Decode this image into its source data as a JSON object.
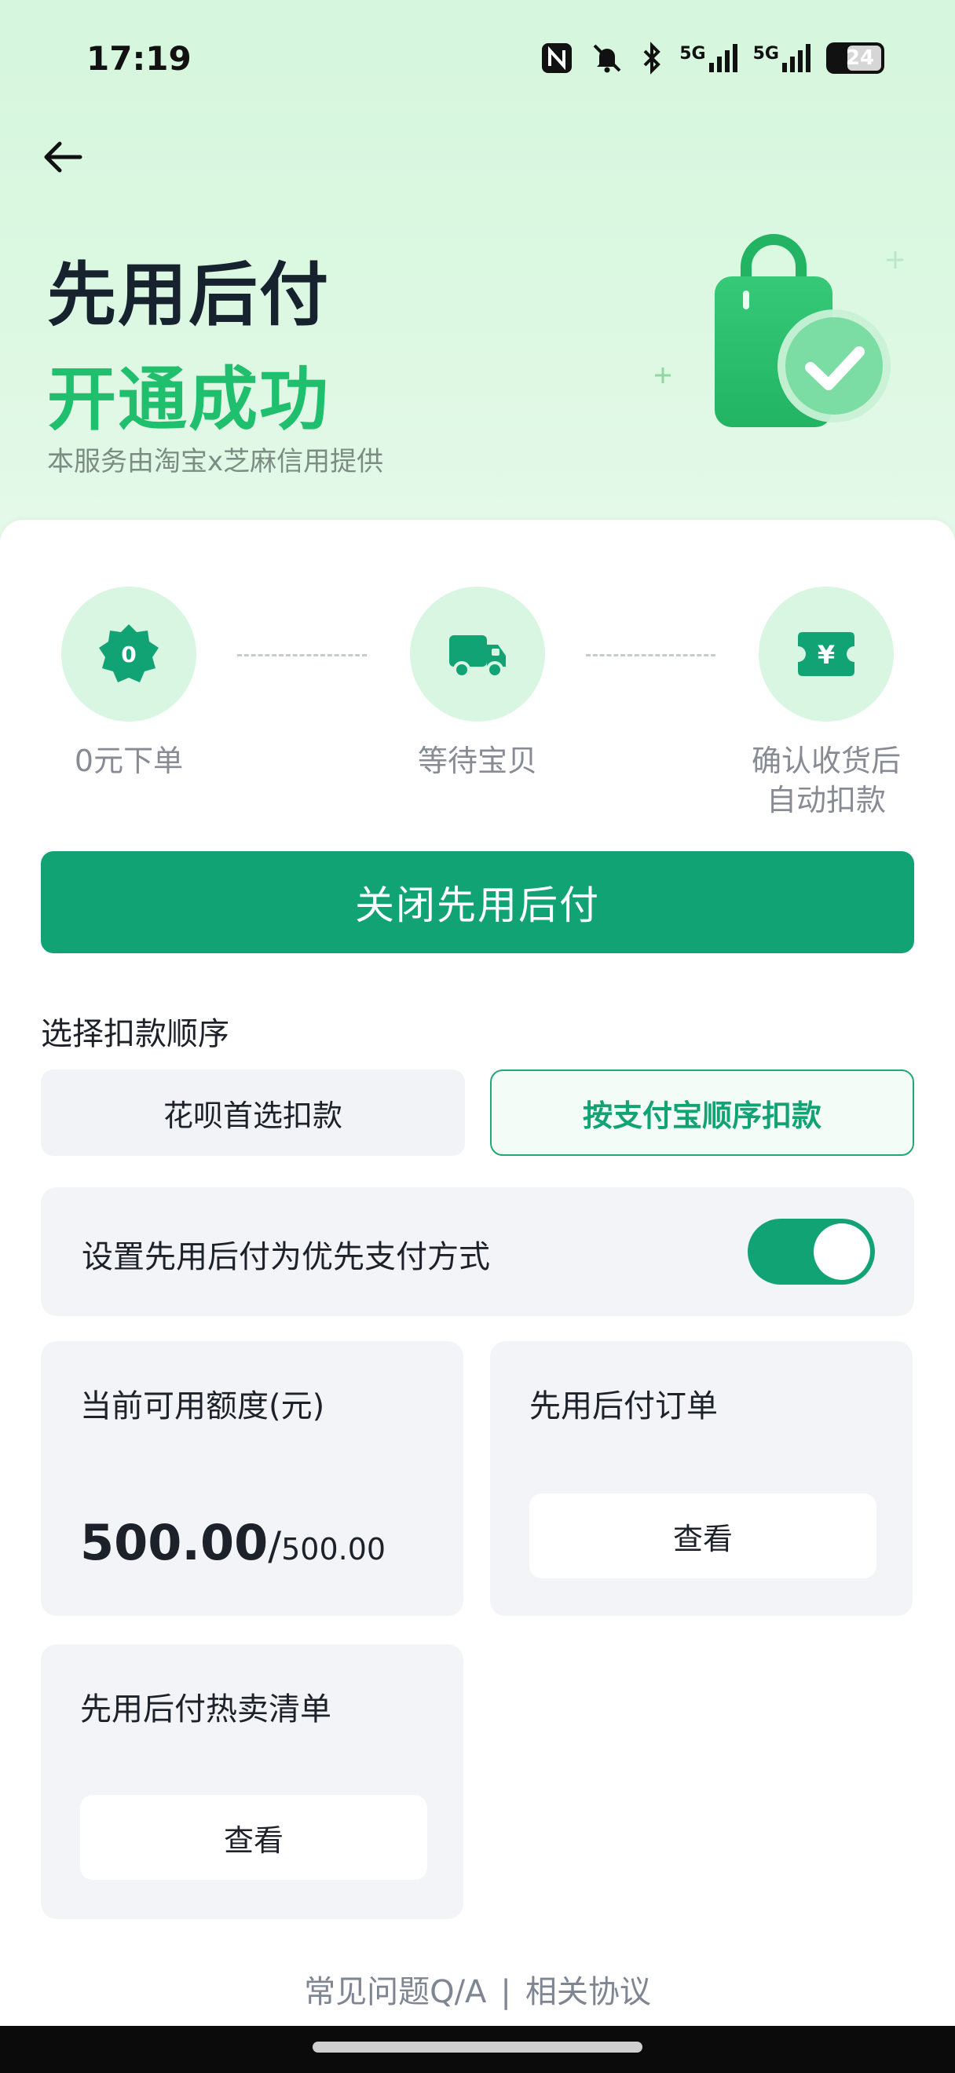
{
  "status_bar": {
    "time": "17:19",
    "icons": [
      "nfc-icon",
      "mute-icon",
      "bluetooth-icon",
      "signal-5g-icon",
      "signal-5g-icon",
      "battery-icon"
    ],
    "network_label_1": "5G",
    "network_label_2": "5G",
    "battery_level": "24"
  },
  "header": {
    "back_icon": "arrow-left-icon",
    "title_line1": "先用后付",
    "title_line2": "开通成功",
    "subtitle": "本服务由淘宝x芝麻信用提供"
  },
  "steps": [
    {
      "icon": "zero-badge-icon",
      "icon_text": "0",
      "label": "0元下单"
    },
    {
      "icon": "truck-icon",
      "label": "等待宝贝"
    },
    {
      "icon": "yuan-ticket-icon",
      "icon_text": "¥",
      "label_line1": "确认收货后",
      "label_line2": "自动扣款"
    }
  ],
  "main_button": {
    "label": "关闭先用后付"
  },
  "payment_order": {
    "title": "选择扣款顺序",
    "options": [
      {
        "label": "花呗首选扣款",
        "selected": false
      },
      {
        "label": "按支付宝顺序扣款",
        "selected": true
      }
    ]
  },
  "preference": {
    "label": "设置先用后付为优先支付方式",
    "enabled": true
  },
  "tiles": {
    "quota": {
      "title": "当前可用额度(元)",
      "available": "500.00",
      "separator": "/",
      "total": "500.00"
    },
    "orders": {
      "title": "先用后付订单",
      "button": "查看"
    },
    "hot_list": {
      "title": "先用后付热卖清单",
      "button": "查看"
    }
  },
  "footer": {
    "faq": "常见问题Q/A",
    "separator": "|",
    "agreement": "相关协议"
  },
  "colors": {
    "accent": "#12a374",
    "title_green": "#1fbf6e",
    "header_bg": "#d6f6dd",
    "tile_bg": "#f2f4f8"
  }
}
